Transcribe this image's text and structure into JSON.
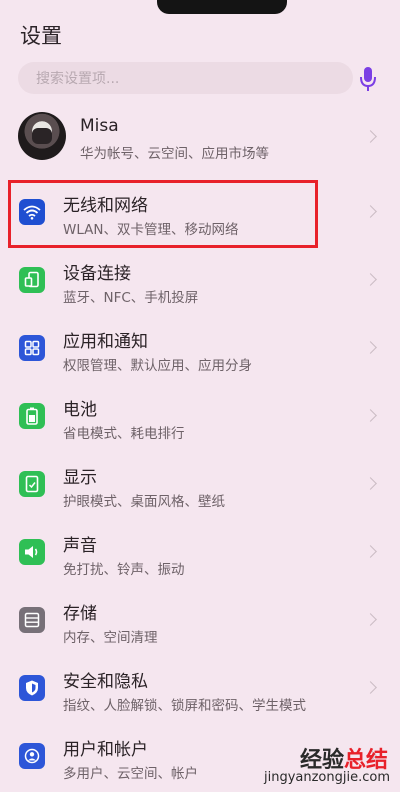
{
  "header": {
    "title": "设置"
  },
  "search": {
    "placeholder": "搜索设置项..."
  },
  "profile": {
    "name": "Misa",
    "subtitle": "华为帐号、云空间、应用市场等"
  },
  "items": [
    {
      "title": "无线和网络",
      "subtitle": "WLAN、双卡管理、移动网络",
      "icon": "wifi-icon",
      "color": "#1f4fd1"
    },
    {
      "title": "设备连接",
      "subtitle": "蓝牙、NFC、手机投屏",
      "icon": "device-connection-icon",
      "color": "#2fbf55"
    },
    {
      "title": "应用和通知",
      "subtitle": "权限管理、默认应用、应用分身",
      "icon": "apps-icon",
      "color": "#2d56d8"
    },
    {
      "title": "电池",
      "subtitle": "省电模式、耗电排行",
      "icon": "battery-icon",
      "color": "#2fbf55"
    },
    {
      "title": "显示",
      "subtitle": "护眼模式、桌面风格、壁纸",
      "icon": "display-icon",
      "color": "#2fbf55"
    },
    {
      "title": "声音",
      "subtitle": "免打扰、铃声、振动",
      "icon": "sound-icon",
      "color": "#2fbf55"
    },
    {
      "title": "存储",
      "subtitle": "内存、空间清理",
      "icon": "storage-icon",
      "color": "#777078"
    },
    {
      "title": "安全和隐私",
      "subtitle": "指纹、人脸解锁、锁屏和密码、学生模式",
      "icon": "shield-icon",
      "color": "#2d56d8"
    },
    {
      "title": "用户和帐户",
      "subtitle": "多用户、云空间、帐户",
      "icon": "user-account-icon",
      "color": "#2d56d8"
    }
  ],
  "watermark": {
    "line1_a": "经验",
    "line1_b": "总结",
    "url": "jingyanzongjie.com"
  },
  "colors": {
    "background": "#f5e6ef",
    "highlight": "#e8212a",
    "mic": "#7b3fe4"
  }
}
